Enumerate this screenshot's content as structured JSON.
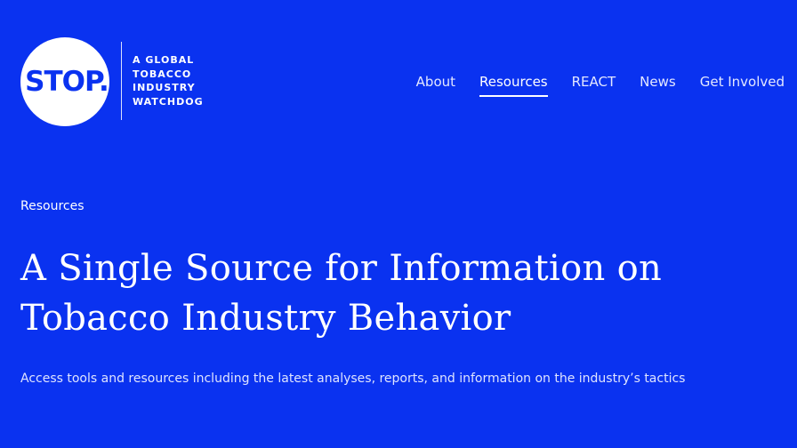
{
  "brand": {
    "logo_text": "STOP.",
    "tagline_lines": [
      "A GLOBAL",
      "TOBACCO",
      "INDUSTRY",
      "WATCHDOG"
    ]
  },
  "nav": {
    "items": [
      {
        "label": "About",
        "active": false
      },
      {
        "label": "Resources",
        "active": true
      },
      {
        "label": "REACT",
        "active": false
      },
      {
        "label": "News",
        "active": false
      },
      {
        "label": "Get Involved",
        "active": false
      }
    ]
  },
  "hero": {
    "breadcrumb": "Resources",
    "title_lines": [
      "A Single Source for Information on",
      "Tobacco Industry Behavior"
    ],
    "subtitle": "Access tools and resources including the latest analyses, reports, and information on the industry’s tactics"
  },
  "colors": {
    "background": "#0a32f0",
    "text": "#ffffff"
  }
}
